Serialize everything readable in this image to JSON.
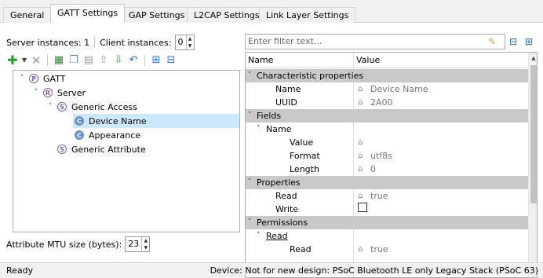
{
  "tabs": [
    {
      "label": "General"
    },
    {
      "label": "GATT Settings",
      "active": true
    },
    {
      "label": "GAP Settings"
    },
    {
      "label": "L2CAP Settings"
    },
    {
      "label": "Link Layer Settings"
    }
  ],
  "instances": {
    "server_label": "Server instances: 1",
    "client_label": "Client instances:",
    "client_value": "0"
  },
  "toolbar_icons": [
    "add-icon",
    "dropdown-arrow-icon",
    "delete-icon",
    "add-service-icon",
    "copy-icon",
    "paste-icon",
    "move-up-icon",
    "move-down-icon",
    "undo-icon",
    "expand-all-icon",
    "collapse-all-icon"
  ],
  "tree": [
    {
      "label": "GATT",
      "badge": "P",
      "level": 0,
      "expanded": true
    },
    {
      "label": "Server",
      "badge": "R",
      "level": 1,
      "expanded": true
    },
    {
      "label": "Generic Access",
      "badge": "S",
      "level": 2,
      "expanded": true
    },
    {
      "label": "Device Name",
      "badge": "C",
      "level": 3,
      "selected": true
    },
    {
      "label": "Appearance",
      "badge": "C",
      "level": 3
    },
    {
      "label": "Generic Attribute",
      "badge": "S",
      "level": 2
    }
  ],
  "mtu": {
    "label": "Attribute MTU size (bytes):",
    "value": "23"
  },
  "filter": {
    "placeholder": "Enter filter text..."
  },
  "grid": {
    "col_name": "Name",
    "col_value": "Value",
    "rows": [
      {
        "name": "Characteristic properties",
        "type": "cat",
        "chev": "˅"
      },
      {
        "name": "Name",
        "value": "Device Name",
        "lock": true
      },
      {
        "name": "UUID",
        "value": "2A00",
        "lock": true
      },
      {
        "name": "Fields",
        "type": "cat",
        "chev": "˅"
      },
      {
        "name": "Name",
        "type": "sub",
        "chev": "˅"
      },
      {
        "name": "Value",
        "value": "",
        "lock": true,
        "deep": true
      },
      {
        "name": "Format",
        "value": "utf8s",
        "lock": true,
        "deep": true
      },
      {
        "name": "Length",
        "value": "0",
        "lock": true,
        "deep": true
      },
      {
        "name": "Properties",
        "type": "cat",
        "chev": "˅"
      },
      {
        "name": "Read",
        "value": "true",
        "lock": true
      },
      {
        "name": "Write",
        "checkbox": true
      },
      {
        "name": "Permissions",
        "type": "cat",
        "chev": "˅"
      },
      {
        "name": "Read",
        "type": "sub",
        "chev": "˅",
        "underline": true
      },
      {
        "name": "Read",
        "value": "true",
        "lock": true,
        "deep": true
      }
    ]
  },
  "status": {
    "left": "Ready",
    "right": "Device: Not for new design: PSoC Bluetooth LE only Legacy Stack (PSoC 63)"
  }
}
